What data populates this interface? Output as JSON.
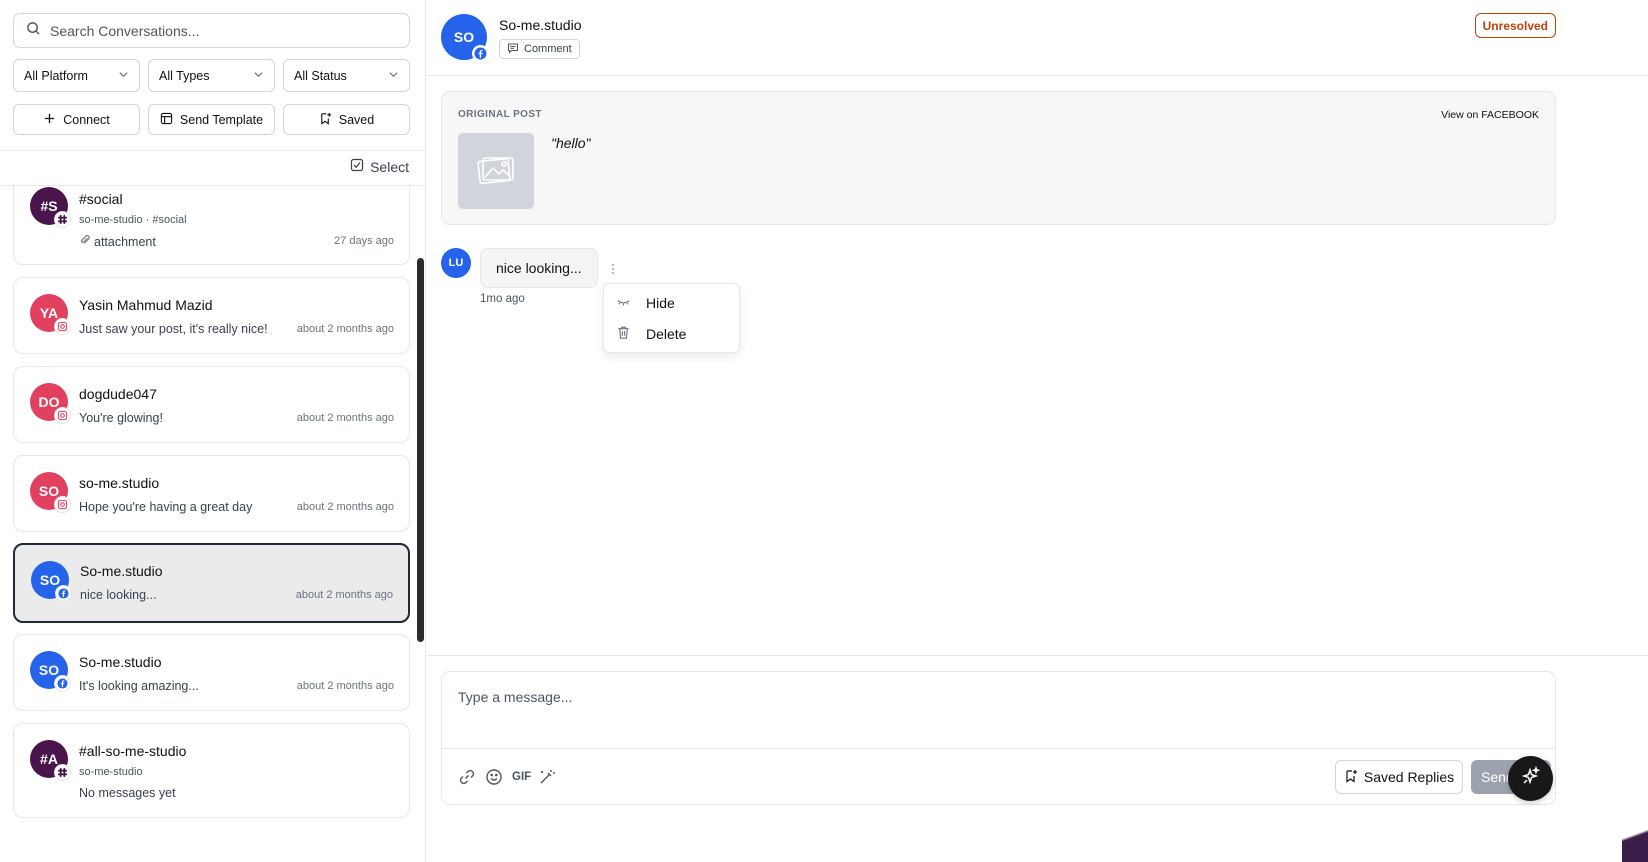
{
  "search": {
    "placeholder": "Search Conversations..."
  },
  "filters": {
    "platform": "All Platform",
    "types": "All Types",
    "status": "All Status"
  },
  "actions": {
    "connect": "Connect",
    "send_template": "Send Template",
    "saved": "Saved"
  },
  "select_label": "Select",
  "conversations": [
    {
      "name": "#social",
      "initials": "#S",
      "sub": "so-me-studio · #social",
      "message": "attachment",
      "time": "27 days ago",
      "platform": "slack",
      "color": "#4a154b"
    },
    {
      "name": "Yasin Mahmud Mazid",
      "initials": "YA",
      "message": "Just saw your post, it's really nice!",
      "time": "about 2 months ago",
      "platform": "instagram",
      "color": "#e1405f"
    },
    {
      "name": "dogdude047",
      "initials": "DO",
      "message": "You're glowing!",
      "time": "about 2 months ago",
      "platform": "instagram",
      "color": "#e1405f"
    },
    {
      "name": "so-me.studio",
      "initials": "SO",
      "message": "Hope you're having a great day",
      "time": "about 2 months ago",
      "platform": "instagram",
      "color": "#e1405f"
    },
    {
      "name": "So-me.studio",
      "initials": "SO",
      "message": "nice looking...",
      "time": "about 2 months ago",
      "platform": "facebook",
      "color": "#2563eb"
    },
    {
      "name": "So-me.studio",
      "initials": "SO",
      "message": "It's looking amazing...",
      "time": "about 2 months ago",
      "platform": "facebook",
      "color": "#2563eb"
    },
    {
      "name": "#all-so-me-studio",
      "initials": "#A",
      "sub": "so-me-studio",
      "message": "No messages yet",
      "time": "",
      "platform": "slack",
      "color": "#4a154b"
    }
  ],
  "header": {
    "initials": "SO",
    "name": "So-me.studio",
    "type_chip": "Comment",
    "status": "Unresolved"
  },
  "post": {
    "label": "ORIGINAL POST",
    "link": "View on FACEBOOK",
    "text": "\"hello\""
  },
  "message": {
    "initials": "LU",
    "text": "nice looking...",
    "time": "1mo ago"
  },
  "context_menu": {
    "hide": "Hide",
    "delete": "Delete"
  },
  "composer": {
    "placeholder": "Type a message...",
    "gif": "GIF",
    "saved_replies": "Saved Replies",
    "send": "Send"
  },
  "colors": {
    "accent_blue": "#2563eb",
    "instagram": "#e1405f",
    "slack": "#4a154b",
    "unresolved": "#c2410c"
  }
}
